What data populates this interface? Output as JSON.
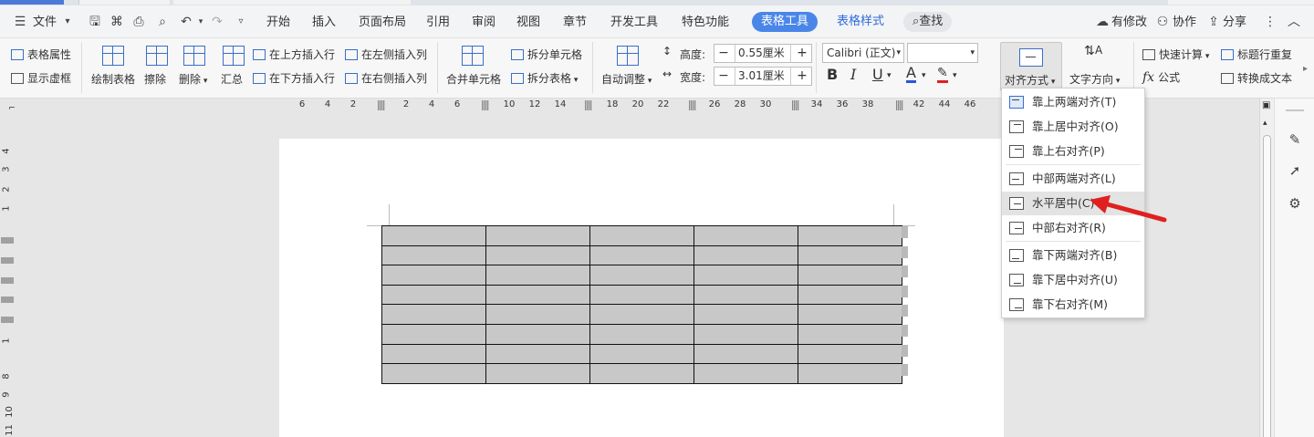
{
  "menubar": {
    "file_label": "文件",
    "tabs": [
      "开始",
      "插入",
      "页面布局",
      "引用",
      "审阅",
      "视图",
      "章节",
      "开发工具",
      "特色功能"
    ],
    "active_tab": "表格工具",
    "second_tab": "表格样式",
    "search": "查找",
    "right": {
      "modified": "有修改",
      "collab": "协作",
      "share": "分享"
    }
  },
  "ribbon": {
    "table_props": "表格属性",
    "show_gridlines": "显示虚框",
    "draw_table": "绘制表格",
    "erase": "擦除",
    "delete": "删除",
    "summary": "汇总",
    "insert_above": "在上方插入行",
    "insert_below": "在下方插入行",
    "insert_left": "在左侧插入列",
    "insert_right": "在右侧插入列",
    "merge_cells": "合并单元格",
    "split_cells": "拆分单元格",
    "split_table": "拆分表格",
    "auto_fit": "自动调整",
    "height_label": "高度:",
    "height_value": "0.55厘米",
    "width_label": "宽度:",
    "width_value": "3.01厘米",
    "font_name": "Calibri (正文)",
    "font_size": "",
    "align_label": "对齐方式",
    "text_direction": "文字方向",
    "quick_calc": "快速计算",
    "formula": "公式",
    "repeat_header": "标题行重复",
    "to_text": "转换成文本"
  },
  "ruler": {
    "numbers": [
      "6",
      "4",
      "2",
      "2",
      "4",
      "6",
      "10",
      "12",
      "14",
      "18",
      "20",
      "22",
      "26",
      "28",
      "30",
      "34",
      "36",
      "38",
      "42",
      "44",
      "46"
    ],
    "vertical": [
      "4",
      "3",
      "2",
      "1",
      "1",
      "8",
      "9",
      "10",
      "11"
    ]
  },
  "table": {
    "rows": 8,
    "cols": 5
  },
  "dropdown": {
    "items": [
      "靠上两端对齐(T)",
      "靠上居中对齐(O)",
      "靠上右对齐(P)",
      "中部两端对齐(L)",
      "水平居中(C)",
      "中部右对齐(R)",
      "靠下两端对齐(B)",
      "靠下居中对齐(U)",
      "靠下右对齐(M)"
    ],
    "highlighted_index": 4,
    "accent": "#e02020"
  },
  "colors": {
    "accent": "#4a86e8",
    "table_fill": "#c8c8c8",
    "arrow": "#e02020"
  }
}
